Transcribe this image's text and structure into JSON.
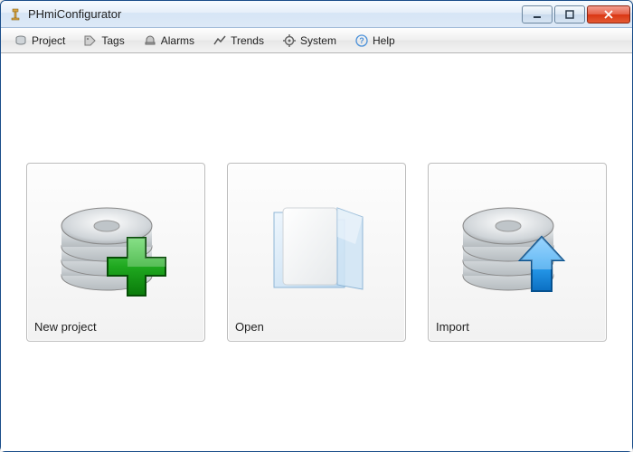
{
  "window": {
    "title": "PHmiConfigurator"
  },
  "menu": {
    "items": [
      {
        "label": "Project",
        "icon": "project-icon"
      },
      {
        "label": "Tags",
        "icon": "tags-icon"
      },
      {
        "label": "Alarms",
        "icon": "alarms-icon"
      },
      {
        "label": "Trends",
        "icon": "trends-icon"
      },
      {
        "label": "System",
        "icon": "system-icon"
      },
      {
        "label": "Help",
        "icon": "help-icon"
      }
    ]
  },
  "cards": [
    {
      "label": "New project",
      "icon": "database-plus"
    },
    {
      "label": "Open",
      "icon": "folder-open"
    },
    {
      "label": "Import",
      "icon": "database-arrow-up"
    }
  ]
}
